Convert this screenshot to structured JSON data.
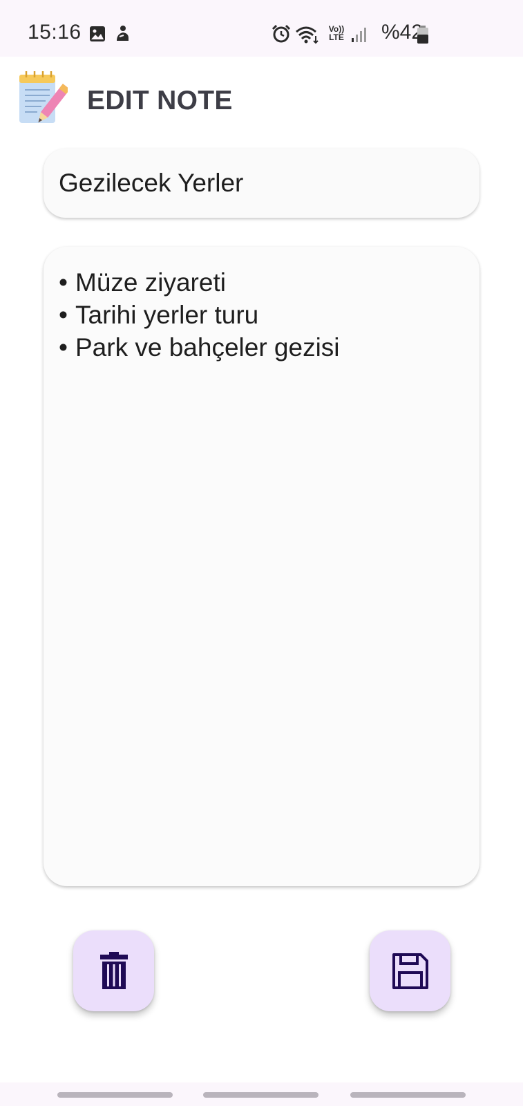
{
  "status_bar": {
    "time": "15:16",
    "battery_text": "%42",
    "icons": [
      "image-icon",
      "person-icon",
      "alarm-icon",
      "wifi-icon",
      "volte-icon",
      "signal-icon",
      "battery-icon"
    ],
    "volte_label_top": "Vo))",
    "volte_label_bottom": "LTE"
  },
  "header": {
    "title": "EDIT NOTE",
    "logo_icon": "notepad-pencil-icon"
  },
  "note": {
    "title_value": "Gezilecek Yerler",
    "bullet": "•",
    "content_lines": [
      "Müze ziyareti",
      "Tarihi yerler turu",
      "Park ve bahçeler gezisi"
    ]
  },
  "actions": {
    "delete_icon": "trash-icon",
    "save_icon": "floppy-disk-icon"
  },
  "colors": {
    "status_bar_bg": "#fbf6fc",
    "fab_bg": "#ebdefb",
    "fab_icon": "#1f0a55",
    "title_text": "#3d3d46"
  }
}
